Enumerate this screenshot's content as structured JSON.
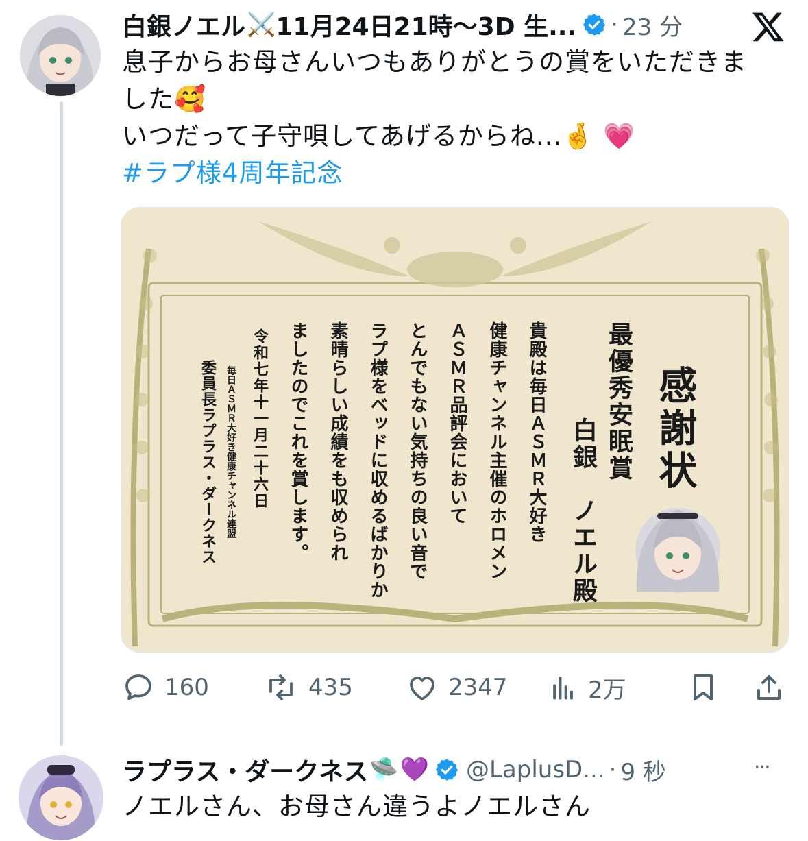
{
  "post1": {
    "display_name": "白銀ノエル",
    "name_glyph": "⚔️",
    "name_suffix": "11月24日21時〜3D 生...",
    "separator": "·",
    "time": "23 分",
    "text_line1": "息子からお母さんいつもありがとうの賞をいただきま",
    "text_line2": "した",
    "emoji_smile": "🥰",
    "text_line3": "いつだって子守唄してあげるからね...",
    "emoji_fingers": "🤞",
    "emoji_heart": "💗",
    "hashtag": "#ラプ様4周年記念",
    "certificate": {
      "title": "感謝状",
      "award": "最優秀安眠賞",
      "recipient": "白銀　ノエル殿",
      "col1": "貴殿は毎日ＡＳＭＲ大好き",
      "col2": "健康チャンネル主催のホロメン",
      "col3": "ＡＳＭＲ品評会において",
      "col4": "とんでもない気持ちの良い音で",
      "col5": "ラプ様をベッドに収めるばかりか",
      "col6": "素晴らしい成績をも収められ",
      "col7": "ましたのでこれを賞します。",
      "date": "令和七年十一月二十六日",
      "org": "毎日ＡＳＭＲ大好き健康チャンネル連盟",
      "chair": "委員長ラプラス・ダークネス"
    },
    "actions": {
      "replies": "160",
      "reposts": "435",
      "likes": "2347",
      "views": "2万"
    }
  },
  "post2": {
    "display_name": "ラプラス・ダークネス",
    "emoji_ufo": "🛸",
    "emoji_heart": "💜",
    "handle": "@LaplusD...",
    "separator": "·",
    "time": "9 秒",
    "more": "···",
    "text": "ノエルさん、お母さん違うよノエルさん"
  },
  "colors": {
    "verified": "#1d9bf0",
    "hashtag": "#1d9bf0",
    "muted": "#536471",
    "thread_line": "#cfd9de",
    "certificate_bg": "#efe6cd",
    "certificate_ornament": "#b9b27a"
  }
}
